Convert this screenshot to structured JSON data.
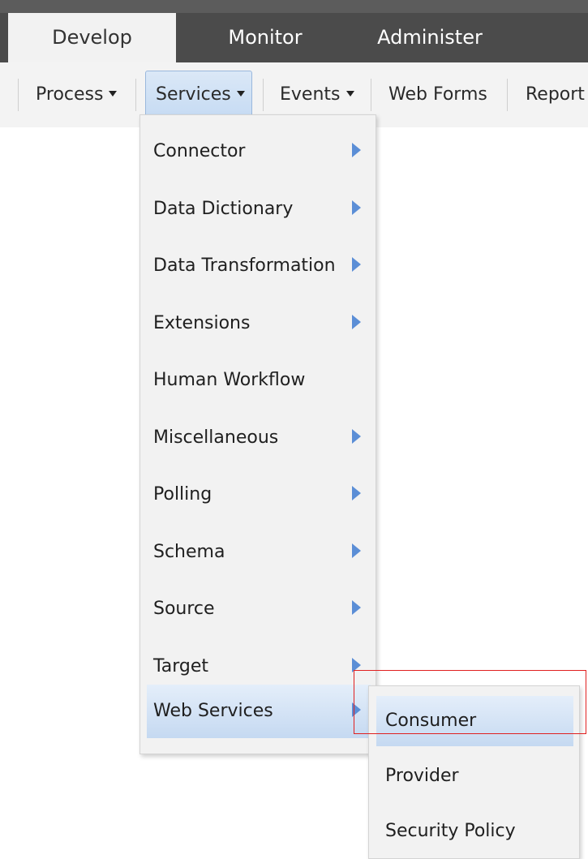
{
  "tabs": [
    {
      "label": "Develop"
    },
    {
      "label": "Monitor"
    },
    {
      "label": "Administer"
    }
  ],
  "nav": [
    {
      "label": "Process"
    },
    {
      "label": "Services"
    },
    {
      "label": "Events"
    },
    {
      "label": "Web Forms"
    },
    {
      "label": "Report"
    }
  ],
  "services_menu": {
    "items": [
      {
        "label": "Connector"
      },
      {
        "label": "Data Dictionary"
      },
      {
        "label": "Data Transformation"
      },
      {
        "label": "Extensions"
      },
      {
        "label": "Human Workflow"
      },
      {
        "label": "Miscellaneous"
      },
      {
        "label": "Polling"
      },
      {
        "label": "Schema"
      },
      {
        "label": "Source"
      },
      {
        "label": "Target"
      },
      {
        "label": "Web Services"
      }
    ]
  },
  "web_services_submenu": {
    "items": [
      {
        "label": "Consumer"
      },
      {
        "label": "Provider"
      },
      {
        "label": "Security Policy"
      }
    ]
  },
  "colors": {
    "highlight_box": "#e02020",
    "submenu_arrow": "#5b8ed6",
    "selected_item": "#c5d9f1"
  }
}
